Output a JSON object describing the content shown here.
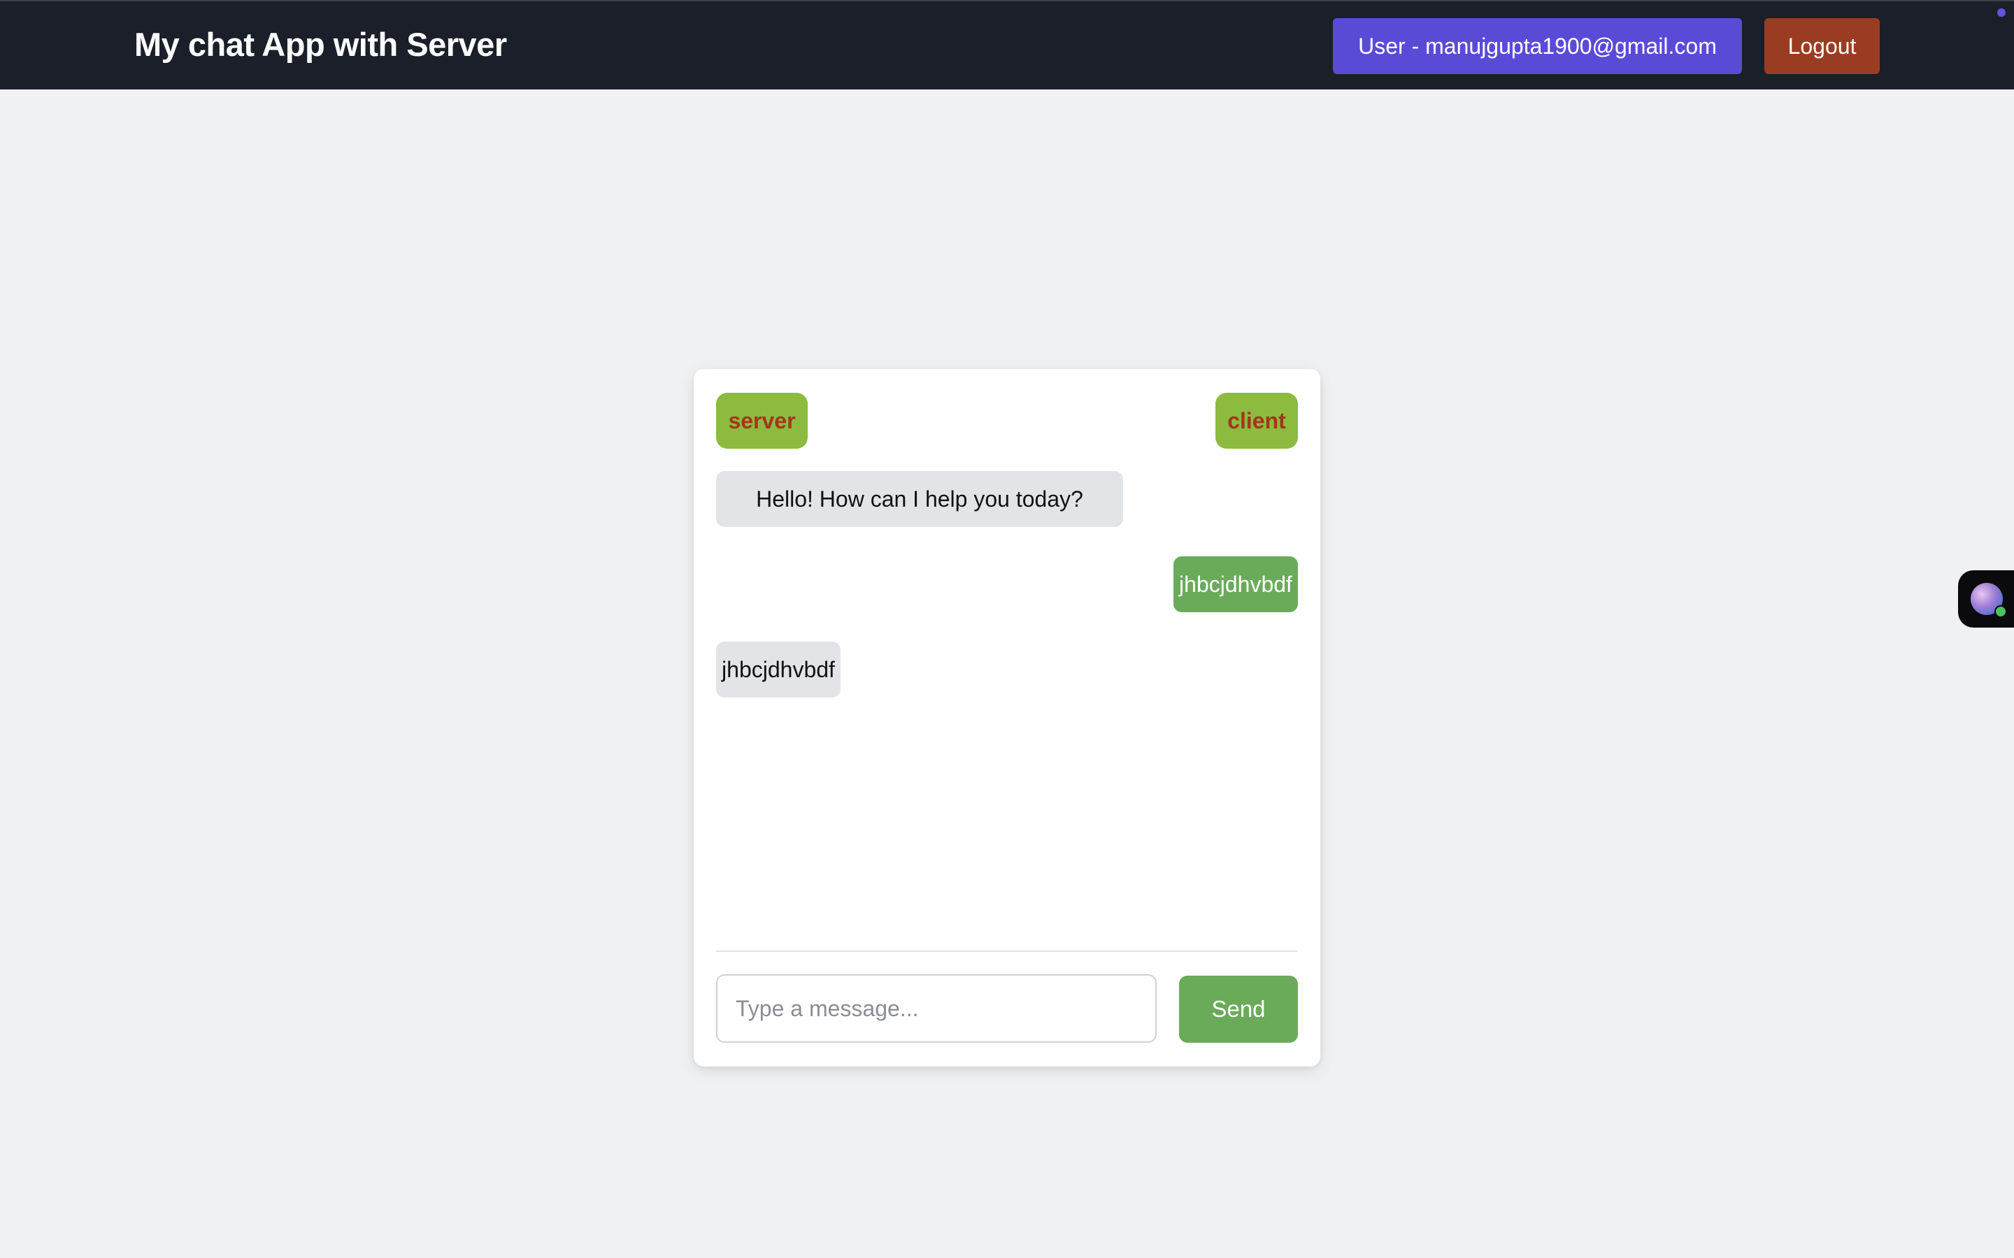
{
  "app": {
    "title": "My chat App with Server"
  },
  "header": {
    "user_label": "User - manujgupta1900@gmail.com",
    "logout_label": "Logout"
  },
  "chat": {
    "server_tag": "server",
    "client_tag": "client",
    "messages": [
      {
        "sender": "server",
        "text": "Hello! How can I help you today?"
      },
      {
        "sender": "client",
        "text": "jhbcjdhvbdf"
      },
      {
        "sender": "server",
        "text": "jhbcjdhvbdf"
      }
    ],
    "input": {
      "value": "",
      "placeholder": "Type a message..."
    },
    "send_label": "Send"
  },
  "colors": {
    "navbar": "#1b1f2a",
    "user_button": "#5a4bd6",
    "logout_button": "#9a3c22",
    "tag_bg": "#8cbb3f",
    "tag_text": "#a3361c",
    "outgoing_bubble": "#6aab5a",
    "incoming_bubble": "#e3e4e8",
    "page_bg": "#f0f1f3"
  },
  "icons": {
    "side_widget": "assistant-avatar-icon"
  }
}
